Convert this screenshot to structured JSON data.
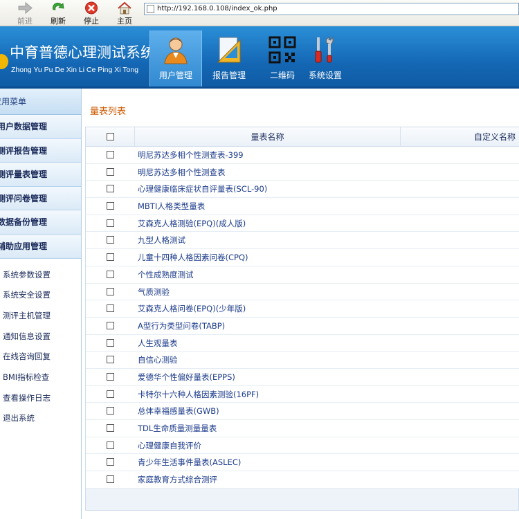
{
  "browser": {
    "back_label": "前进",
    "refresh_label": "刷新",
    "stop_label": "停止",
    "home_label": "主页",
    "url": "http://192.168.0.108/index_ok.php"
  },
  "header": {
    "title": "中育普德心理测试系统",
    "subtitle": "Zhong Yu Pu De Xin Li Ce Ping Xi Tong",
    "tabs": [
      {
        "label": "用户管理",
        "icon": "user-icon",
        "active": true
      },
      {
        "label": "报告管理",
        "icon": "report-icon",
        "active": false
      },
      {
        "label": "二维码",
        "icon": "qrcode-icon",
        "active": false
      },
      {
        "label": "系统设置",
        "icon": "tools-icon",
        "active": false
      }
    ]
  },
  "sidebar": {
    "head": "应用菜单",
    "groups": [
      "用户数据管理",
      "测评报告管理",
      "测评量表管理",
      "测评问卷管理",
      "数据备份管理",
      "辅助应用管理"
    ],
    "subitems": [
      "系统参数设置",
      "系统安全设置",
      "测评主机管理",
      "通知信息设置",
      "在线咨询回复",
      "BMI指标检查",
      "查看操作日志",
      "退出系统"
    ]
  },
  "main": {
    "section_title": "量表列表",
    "columns": {
      "name": "量表名称",
      "custom": "自定义名称"
    },
    "rows": [
      "明尼苏达多相个性测查表-399",
      "明尼苏达多相个性测查表",
      "心理健康临床症状自评量表(SCL-90)",
      "MBTI人格类型量表",
      "艾森克人格测验(EPQ)(成人版)",
      "九型人格测试",
      "儿童十四种人格因素问卷(CPQ)",
      "个性成熟度测试",
      "气质测验",
      "艾森克人格问卷(EPQ)(少年版)",
      "A型行为类型问卷(TABP)",
      "人生观量表",
      "自信心测验",
      "爱德华个性偏好量表(EPPS)",
      "卡特尔十六种人格因素测验(16PF)",
      "总体幸福感量表(GWB)",
      "TDL生命质量测量量表",
      "心理健康自我评价",
      "青少年生活事件量表(ASLEC)",
      "家庭教育方式综合测评"
    ]
  }
}
